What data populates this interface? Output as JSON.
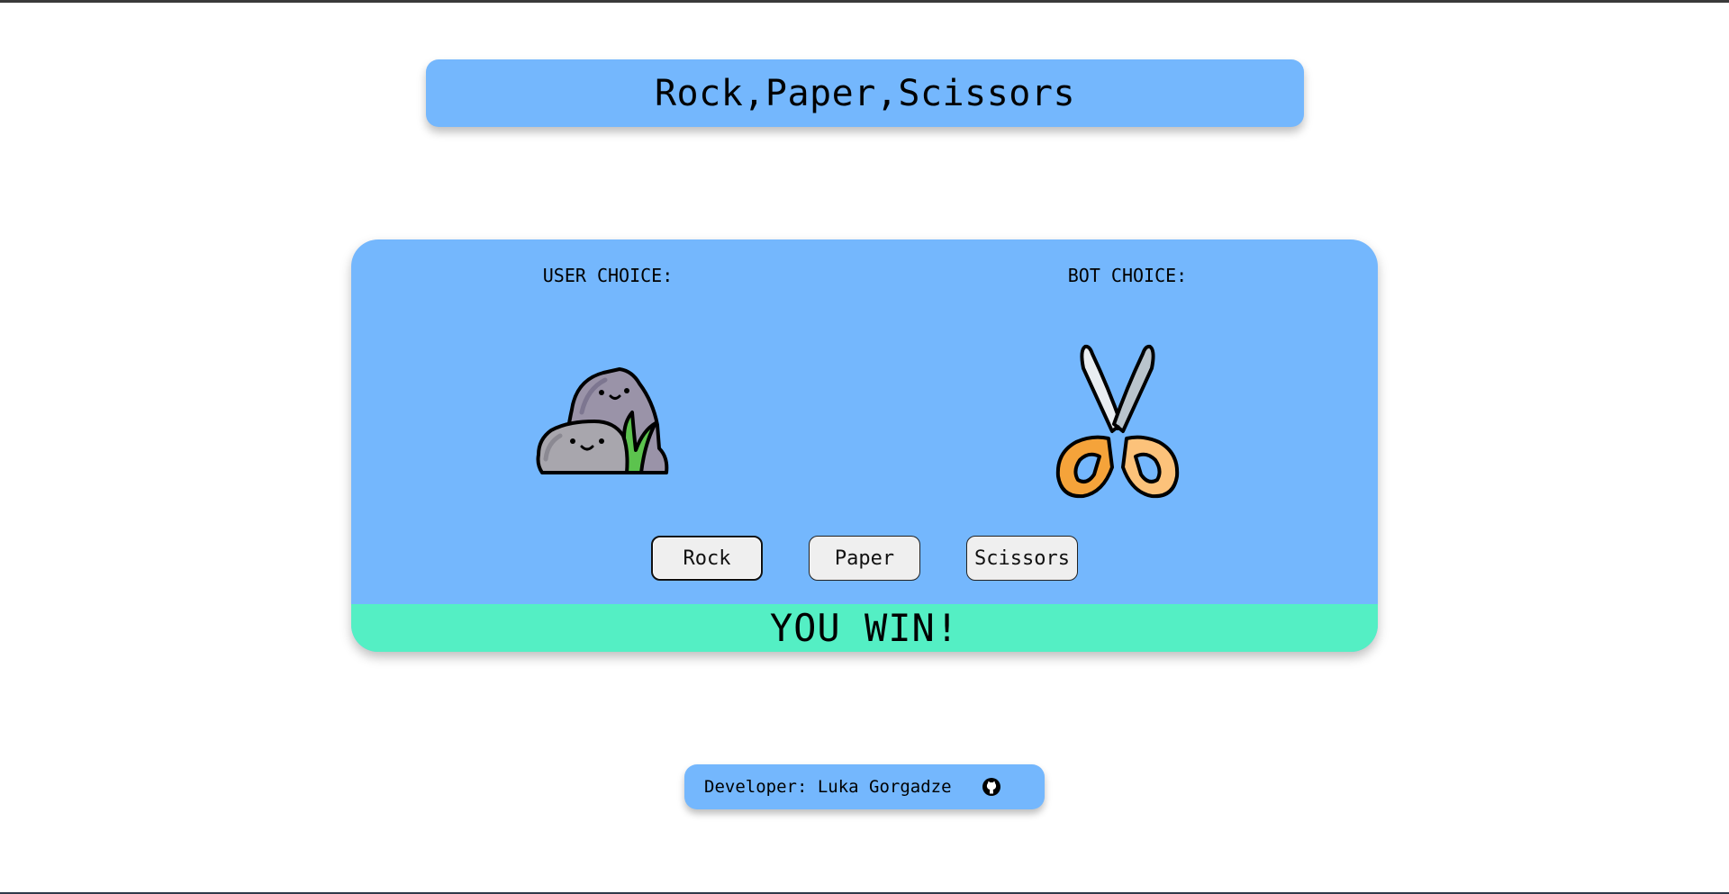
{
  "header": {
    "title": "Rock,Paper,Scissors"
  },
  "game": {
    "user_label": "USER CHOICE:",
    "bot_label": "BOT CHOICE:",
    "user_choice_icon": "rock-icon",
    "bot_choice_icon": "scissors-icon",
    "buttons": {
      "rock": "Rock",
      "paper": "Paper",
      "scissors": "Scissors"
    },
    "result": "YOU WIN!"
  },
  "footer": {
    "developer_text": "Developer: Luka Gorgadze",
    "link_icon": "github-icon"
  },
  "colors": {
    "panel": "#74b7fd",
    "result": "#54efc4",
    "button": "#efefef"
  }
}
